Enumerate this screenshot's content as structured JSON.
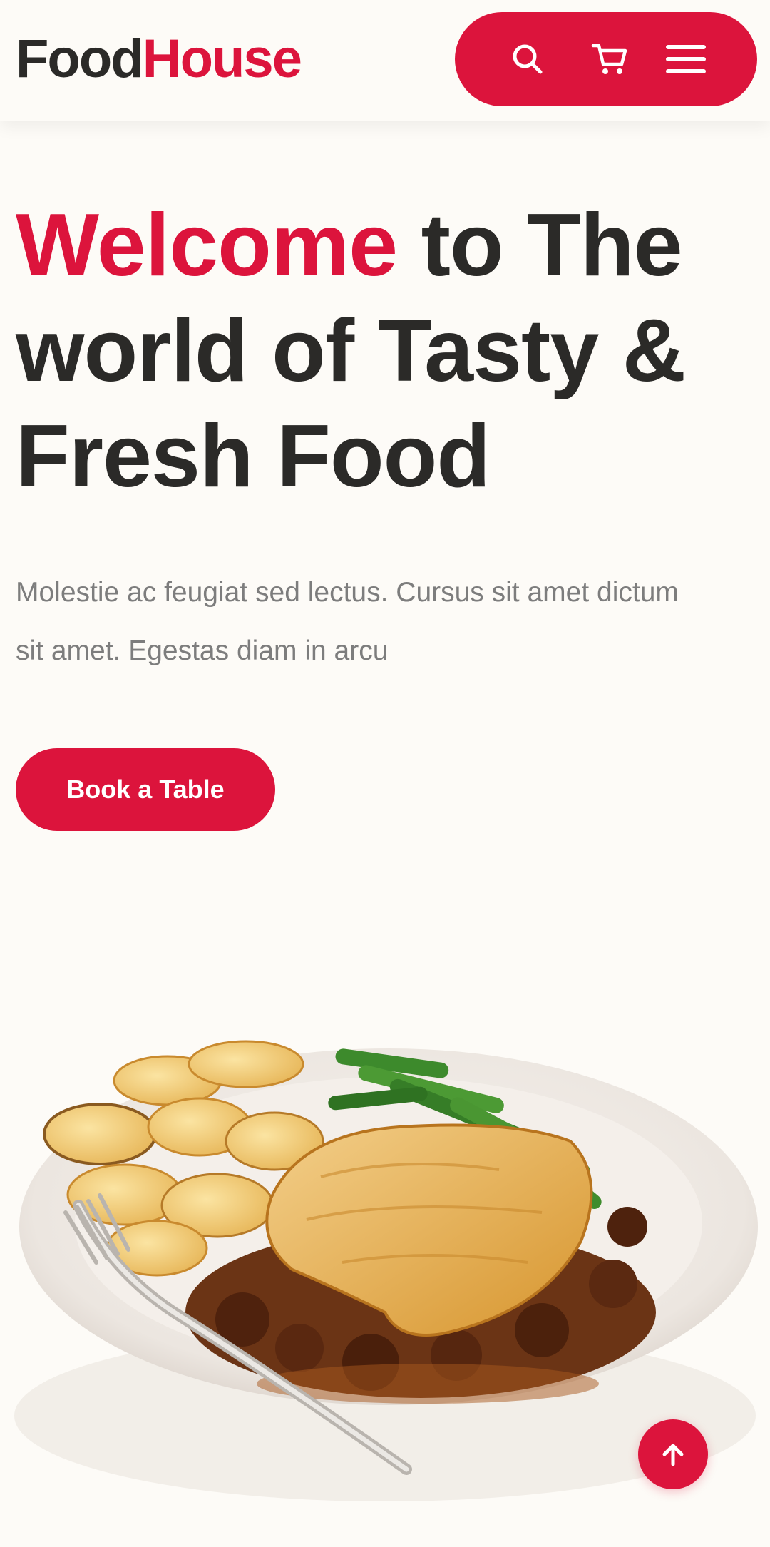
{
  "brand": {
    "part1": "Food",
    "part2": "House"
  },
  "header": {
    "icons": [
      "search-icon",
      "cart-icon",
      "menu-icon"
    ]
  },
  "hero": {
    "title_accent": "Welcome",
    "title_rest": " to The world of Tasty & Fresh Food",
    "subtitle": "Molestie ac feugiat sed lectus. Cursus sit amet dictum sit amet. Egestas diam in arcu",
    "cta_label": "Book a Table",
    "image": "plated-pie-with-potatoes-and-green-beans"
  },
  "floating": {
    "icon": "arrow-up-icon"
  },
  "colors": {
    "accent": "#dc143c",
    "text": "#2b2a28",
    "muted": "#7d7d7d",
    "background": "#fdfbf7"
  }
}
